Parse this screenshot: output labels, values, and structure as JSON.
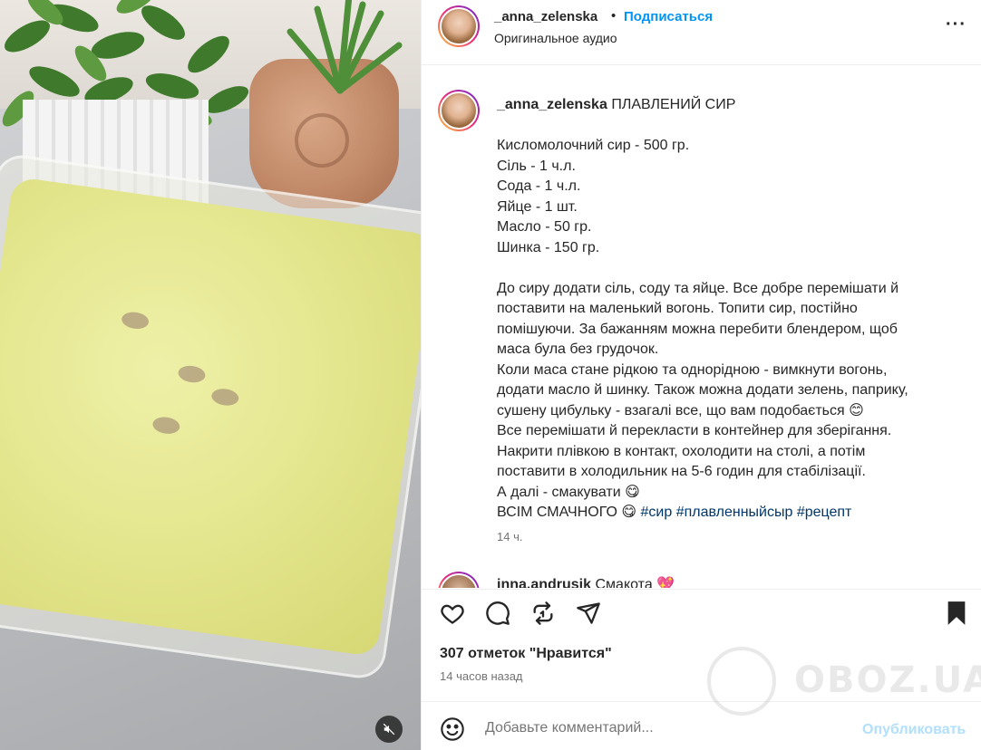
{
  "header": {
    "username": "_anna_zelenska",
    "separator": "•",
    "follow_label": "Подписаться",
    "audio_label": "Оригинальное аудио",
    "more_icon": "more-options-icon"
  },
  "caption": {
    "username": "_anna_zelenska",
    "title": "ПЛАВЛЕНИЙ СИР",
    "ingredients": [
      "Кисломолочний сир - 500 гр.",
      "Сіль - 1 ч.л.",
      "Сода - 1 ч.л.",
      "Яйце - 1 шт.",
      "Масло - 50 гр.",
      "Шинка - 150 гр."
    ],
    "steps": [
      "До сиру додати сіль, соду та яйце. Все добре перемішати й",
      "поставити на маленький вогонь. Топити сир, постійно",
      "помішуючи. За бажанням можна перебити блендером, щоб",
      "маса була без грудочок.",
      "Коли маса стане рідкою та однорідною - вимкнути вогонь,",
      "додати масло й шинку. Також можна додати зелень, паприку,",
      "сушену цибульку - взагалі все, що вам подобається 😊",
      "Все перемішати й перекласти в контейнер для зберігання.",
      "Накрити плівкою в контакт, охолодити на столі, а потім",
      "поставити в холодильник на 5-6 годин для стабілізації.",
      "А далі - смакувати 😋"
    ],
    "final_line": "ВСІМ СМАЧНОГО 😋",
    "hashtags": [
      "#сир",
      "#плавленныйсыр",
      "#рецепт"
    ],
    "time": "14 ч."
  },
  "comment": {
    "username": "inna.andrusik",
    "text": "Смакота 💖"
  },
  "actions": {
    "likes_text": "307 отметок \"Нравится\"",
    "posted_text": "14 часов назад"
  },
  "comment_bar": {
    "placeholder": "Добавьте комментарий...",
    "publish_label": "Опубликовать"
  },
  "watermark": {
    "text": "OBOZ.UA"
  },
  "colors": {
    "accent_blue": "#0095f6",
    "hashtag_blue": "#00376b",
    "muted_text": "#737373",
    "publish_disabled": "#b2dffc"
  }
}
